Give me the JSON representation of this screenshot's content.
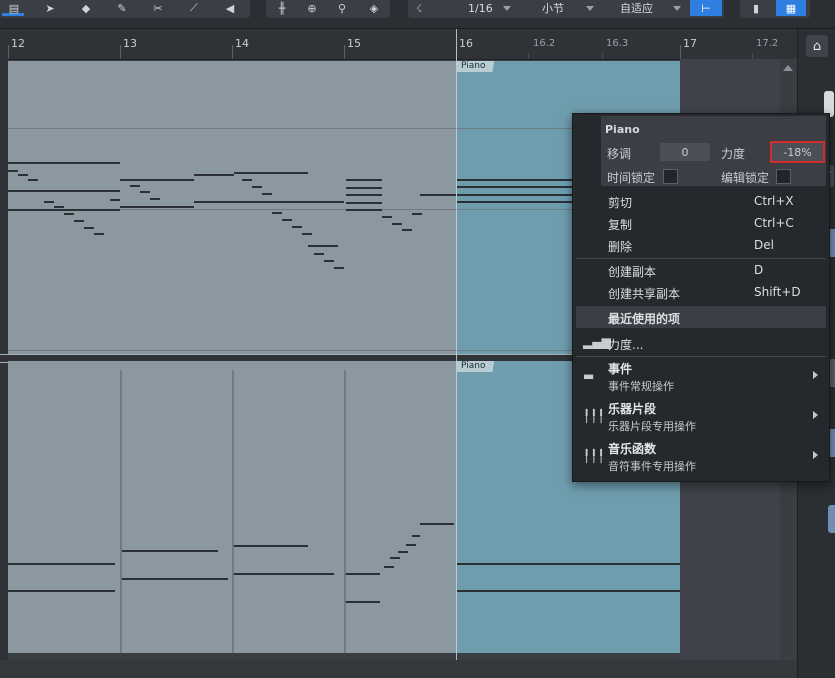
{
  "toolbar": {
    "quantize": "1/16",
    "timebase": "小节",
    "snap": "自适应"
  },
  "ruler": {
    "bars": [
      "12",
      "13",
      "14",
      "15",
      "16",
      "17"
    ],
    "subdivisions": [
      "16.2",
      "16.3",
      "17.2"
    ]
  },
  "tracks": [
    {
      "event_label": "Piano"
    },
    {
      "event_label": "Piano"
    }
  ],
  "context_menu": {
    "title": "Piano",
    "transpose_label": "移调",
    "transpose_value": "0",
    "velocity_label": "力度",
    "velocity_value": "-18%",
    "time_lock_label": "时间锁定",
    "edit_lock_label": "编辑锁定",
    "items": [
      {
        "label": "剪切",
        "shortcut": "Ctrl+X"
      },
      {
        "label": "复制",
        "shortcut": "Ctrl+C"
      },
      {
        "label": "删除",
        "shortcut": "Del"
      },
      {
        "label": "创建副本",
        "shortcut": "D"
      },
      {
        "label": "创建共享副本",
        "shortcut": "Shift+D"
      }
    ],
    "recent_header": "最近使用的项",
    "velocity_item": "力度...",
    "submenus": [
      {
        "title": "事件",
        "subtitle": "事件常规操作"
      },
      {
        "title": "乐器片段",
        "subtitle": "乐器片段专用操作"
      },
      {
        "title": "音乐函数",
        "subtitle": "音符事件专用操作"
      }
    ]
  },
  "colors": {
    "lane": "#8b98a0",
    "selection": "#6e9eae",
    "accent_blue": "#2f7fe0",
    "highlight_red": "#d42b2b"
  }
}
